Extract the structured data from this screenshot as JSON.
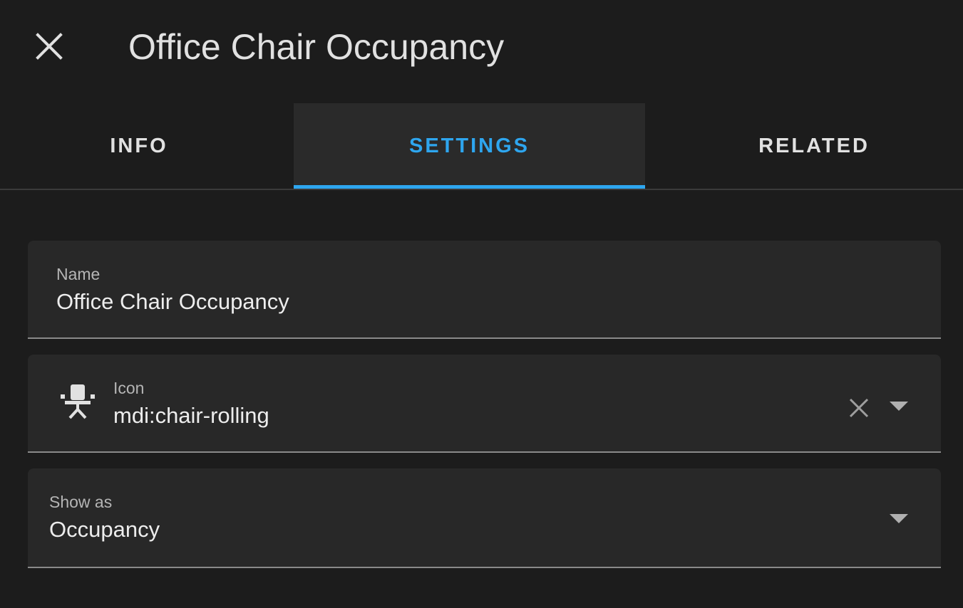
{
  "header": {
    "close_icon": "close-icon",
    "title": "Office Chair Occupancy"
  },
  "tabs": [
    {
      "label": "INFO",
      "active": false
    },
    {
      "label": "SETTINGS",
      "active": true
    },
    {
      "label": "RELATED",
      "active": false
    }
  ],
  "form": {
    "name": {
      "label": "Name",
      "value": "Office Chair Occupancy"
    },
    "icon": {
      "label": "Icon",
      "value": "mdi:chair-rolling",
      "preview_icon": "chair-rolling-icon"
    },
    "show_as": {
      "label": "Show as",
      "value": "Occupancy"
    }
  },
  "colors": {
    "background": "#1c1c1c",
    "field_background": "#282828",
    "accent": "#2ea6ef"
  }
}
